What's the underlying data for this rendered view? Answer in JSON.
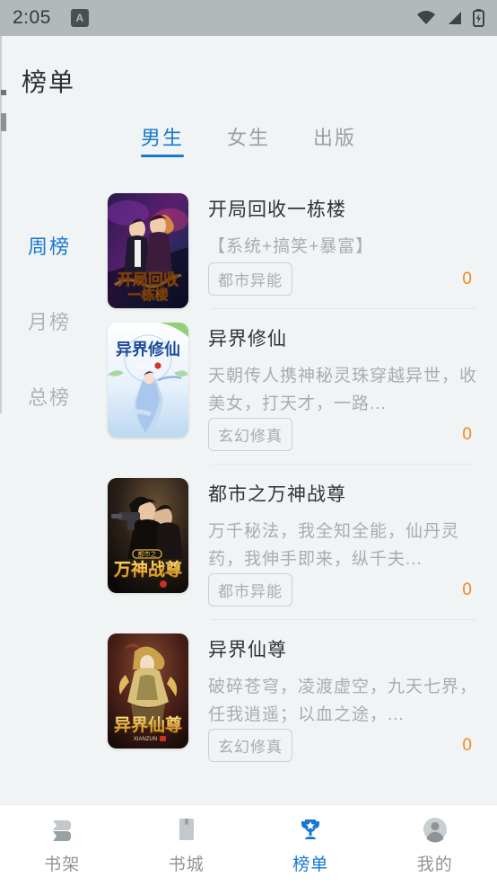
{
  "status_bar": {
    "time": "2:05",
    "app_badge": "A",
    "icons": [
      "wifi-icon",
      "signal-icon",
      "battery-charging-icon"
    ]
  },
  "header": {
    "title": "榜单"
  },
  "tabs": [
    {
      "label": "男生",
      "active": true
    },
    {
      "label": "女生",
      "active": false
    },
    {
      "label": "出版",
      "active": false
    }
  ],
  "sidenav": [
    {
      "label": "周榜",
      "active": true
    },
    {
      "label": "月榜",
      "active": false
    },
    {
      "label": "总榜",
      "active": false
    }
  ],
  "books": [
    {
      "title": "开局回收一栋楼",
      "desc": "【系统+搞笑+暴富】",
      "tag": "都市异能",
      "count": "0",
      "cover_name": "cover-kaiju-huishou"
    },
    {
      "title": "异界修仙",
      "desc": "天朝传人携神秘灵珠穿越异世，收美女，打天才，一路...",
      "tag": "玄幻修真",
      "count": "0",
      "cover_name": "cover-yijie-xiuxian"
    },
    {
      "title": "都市之万神战尊",
      "desc": "万千秘法，我全知全能，仙丹灵药，我伸手即来，纵千夫...",
      "tag": "都市异能",
      "count": "0",
      "cover_name": "cover-dushi-wanshen"
    },
    {
      "title": "异界仙尊",
      "desc": "破碎苍穹，凌渡虚空，九天七界，任我逍遥；以血之途，...",
      "tag": "玄幻修真",
      "count": "0",
      "cover_name": "cover-yijie-xianzun"
    }
  ],
  "bottom_nav": [
    {
      "label": "书架",
      "icon": "books-stack-icon",
      "active": false
    },
    {
      "label": "书城",
      "icon": "bookmark-book-icon",
      "active": false
    },
    {
      "label": "榜单",
      "icon": "trophy-icon",
      "active": true
    },
    {
      "label": "我的",
      "icon": "person-icon",
      "active": false
    }
  ],
  "colors": {
    "accent": "#1878d0",
    "count": "#f5851f",
    "page_bg": "#f1f4f5",
    "statusbar_bg": "#b3b8b9"
  }
}
